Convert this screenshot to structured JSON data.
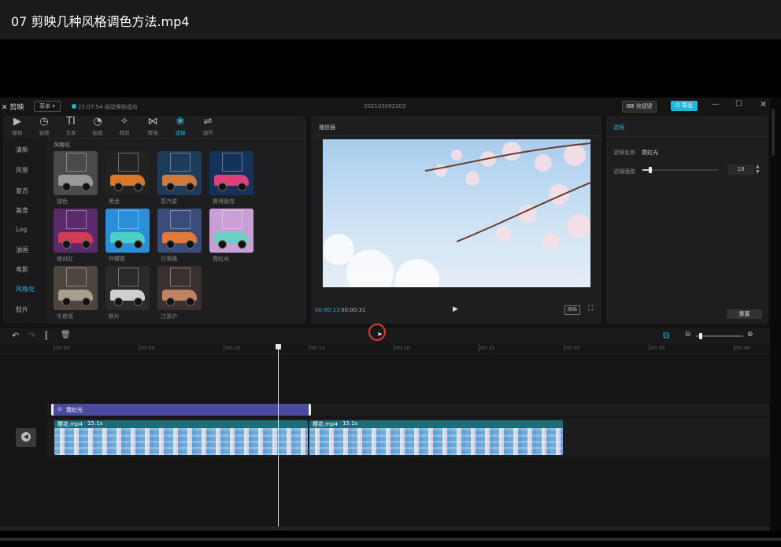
{
  "video_title": "07  剪映几种风格调色方法.mp4",
  "app": {
    "logo": "剪映",
    "menu_label": "菜单",
    "autosave": "22:07:54 自动保存成功",
    "project_name": "202103092203",
    "shortcut_label": "快捷键",
    "export_label": "导出",
    "accent": "#1fb7d8"
  },
  "media_tabs": [
    {
      "label": "媒体",
      "icon": "▶"
    },
    {
      "label": "音频",
      "icon": "◷"
    },
    {
      "label": "文本",
      "icon": "TI"
    },
    {
      "label": "贴纸",
      "icon": "◔"
    },
    {
      "label": "特效",
      "icon": "✧"
    },
    {
      "label": "转场",
      "icon": "⋈"
    },
    {
      "label": "滤镜",
      "icon": "❀"
    },
    {
      "label": "调节",
      "icon": "⇌"
    }
  ],
  "active_tab": "滤镜",
  "categories": [
    "清新",
    "风景",
    "复古",
    "美食",
    "Log",
    "油画",
    "电影",
    "风格化",
    "胶片"
  ],
  "active_category": "风格化",
  "section_title": "风格化",
  "filters": [
    {
      "name": "褪色",
      "bg": "#4a4a4a",
      "car": "#9a9a9a"
    },
    {
      "name": "黑金",
      "bg": "#222222",
      "car": "#d7782a"
    },
    {
      "name": "蒸汽波",
      "bg": "#1e3b5a",
      "car": "#d17a3d"
    },
    {
      "name": "赛博朋克",
      "bg": "#15335a",
      "car": "#e0407a"
    },
    {
      "name": "绝对红",
      "bg": "#5a2a6a",
      "car": "#d13b55"
    },
    {
      "name": "柠檬霞",
      "bg": "#2a8fd8",
      "car": "#4bd0c5"
    },
    {
      "name": "日落橘",
      "bg": "#3a4d7a",
      "car": "#e07a3a"
    },
    {
      "name": "霓虹光",
      "bg": "#c9a0d6",
      "car": "#6ad0c5"
    },
    {
      "name": "牛皮纸",
      "bg": "#4d463f",
      "car": "#a89e90"
    },
    {
      "name": "默片",
      "bg": "#2a2a2a",
      "car": "#cfcfcf"
    },
    {
      "name": "江浙沪",
      "bg": "#3a3030",
      "car": "#c08260"
    }
  ],
  "player": {
    "title": "播放器",
    "current_time": "00:00:13",
    "total_time": "00:00:31",
    "ratio_label": "原始"
  },
  "filter_panel": {
    "tab": "滤镜",
    "name_label": "滤镜名称",
    "name_value": "霓虹光",
    "strength_label": "滤镜强度",
    "strength_value": "10",
    "reset_label": "重置"
  },
  "timeline": {
    "ticks": [
      "00:00",
      "00:05",
      "00:10",
      "00:15",
      "00:20",
      "00:25",
      "00:30",
      "00:35",
      "00:40"
    ],
    "filter_clip_label": "霓虹光",
    "clips": [
      {
        "name": "樱花.mp4",
        "duration": "15.1s"
      },
      {
        "name": "樱花.mp4",
        "duration": "15.1s"
      }
    ]
  }
}
